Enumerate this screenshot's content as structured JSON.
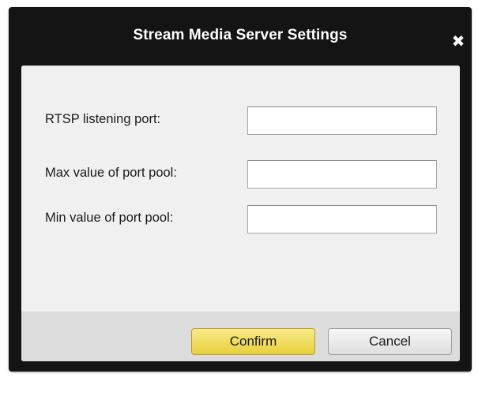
{
  "dialog": {
    "title": "Stream Media Server Settings",
    "close_glyph": "✖",
    "close_icon": "close-icon"
  },
  "form": {
    "rtsp_port": {
      "label": "RTSP listening port:",
      "value": ""
    },
    "max_port_pool": {
      "label": "Max value of port pool:",
      "value": ""
    },
    "min_port_pool": {
      "label": "Min value of port pool:",
      "value": ""
    }
  },
  "footer": {
    "confirm_label": "Confirm",
    "cancel_label": "Cancel"
  },
  "colors": {
    "titlebar": "#141414",
    "confirm_button": "#f2dc5a",
    "cancel_button": "#e6e6e6"
  }
}
